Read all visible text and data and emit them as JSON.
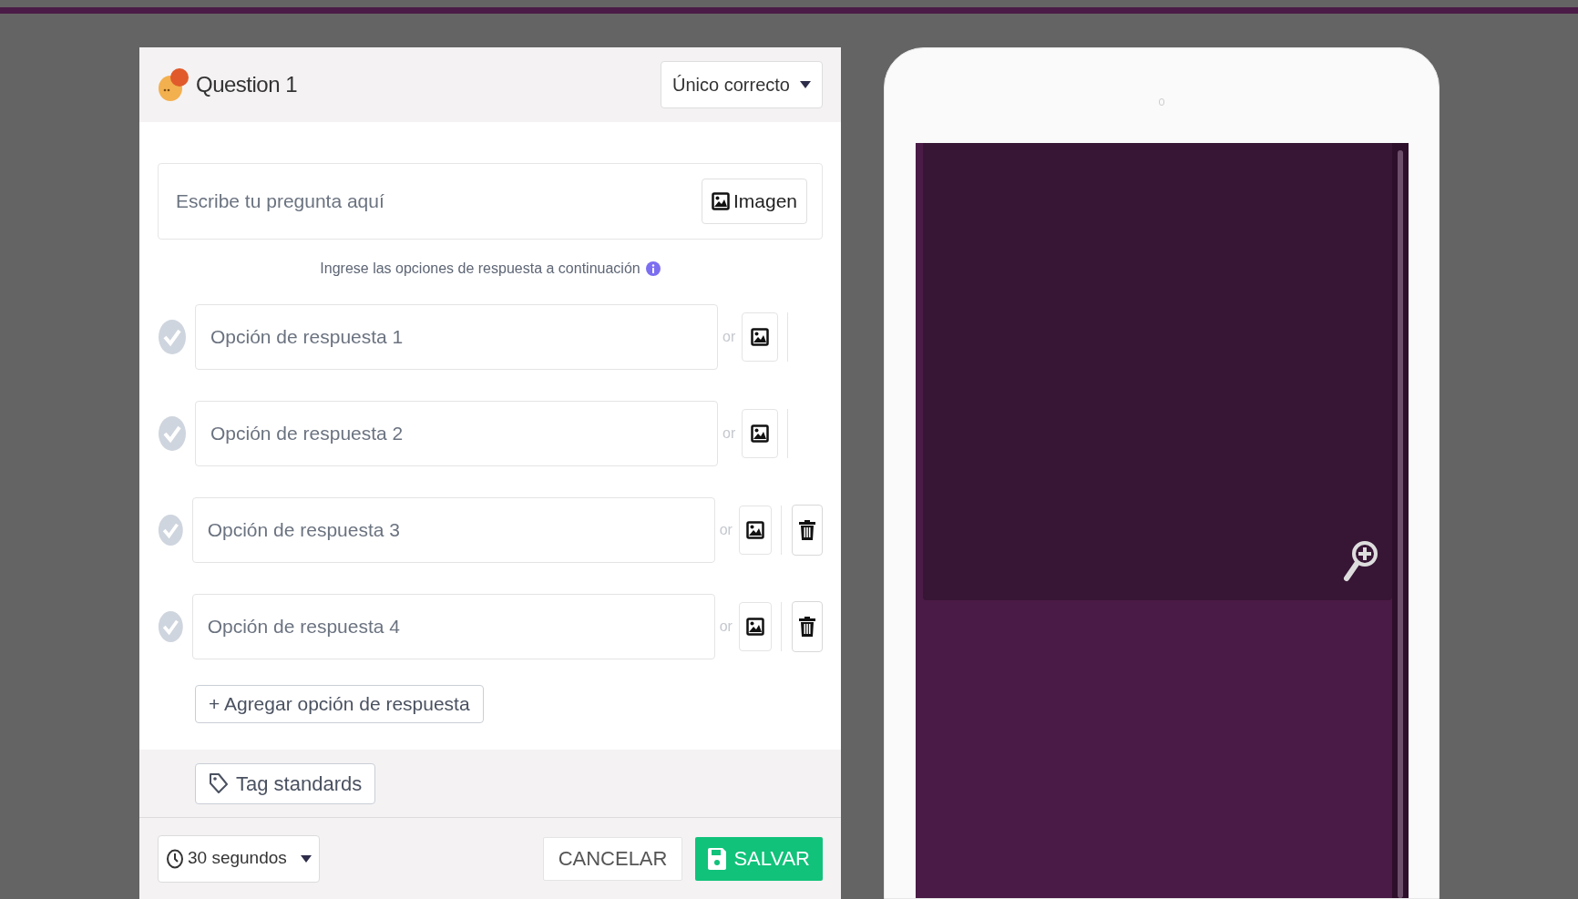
{
  "header": {
    "title": "Question 1",
    "type_select": "Único correcto"
  },
  "question": {
    "placeholder": "Escribe tu pregunta aquí",
    "image_button": "Imagen"
  },
  "hint": "Ingrese las opciones de respuesta a continuación",
  "options": [
    {
      "placeholder": "Opción de respuesta 1",
      "or": "or",
      "correct": false,
      "deletable": false
    },
    {
      "placeholder": "Opción de respuesta 2",
      "or": "or",
      "correct": false,
      "deletable": false
    },
    {
      "placeholder": "Opción de respuesta 3",
      "or": "or",
      "correct": false,
      "deletable": true
    },
    {
      "placeholder": "Opción de respuesta 4",
      "or": "or",
      "correct": false,
      "deletable": true
    }
  ],
  "add_option": "+ Agregar opción de respuesta",
  "tag_button": "Tag standards",
  "timer": "30 segundos",
  "cancel": "CANCELAR",
  "save": "SALVAR"
}
